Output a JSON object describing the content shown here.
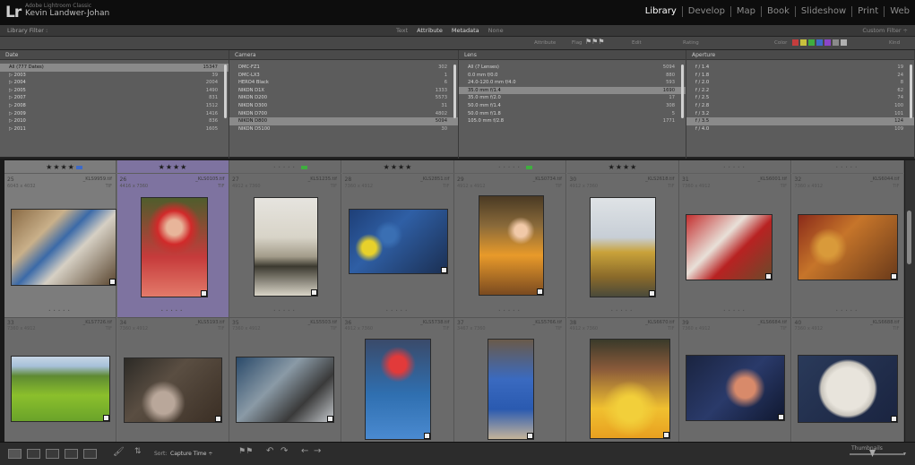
{
  "identity": {
    "logo": "Lr",
    "app_name": "Adobe Lightroom Classic",
    "user": "Kevin Landwer-Johan"
  },
  "modules": [
    {
      "label": "Library",
      "active": true
    },
    {
      "label": "Develop"
    },
    {
      "label": "Map"
    },
    {
      "label": "Book"
    },
    {
      "label": "Slideshow"
    },
    {
      "label": "Print"
    },
    {
      "label": "Web"
    }
  ],
  "library_filter": {
    "title": "Library Filter :",
    "tabs": [
      {
        "label": "Text"
      },
      {
        "label": "Attribute",
        "active": true
      },
      {
        "label": "Metadata",
        "active": true
      },
      {
        "label": "None"
      }
    ],
    "custom": "Custom Filter ÷"
  },
  "attribute_bar": {
    "attribute": "Attribute",
    "flag": "Flag",
    "edit": "Edit",
    "rating": "Rating",
    "color": "Color",
    "kind": "Kind",
    "colors": [
      "#c43d3d",
      "#c9c13d",
      "#3fae3f",
      "#3e6ac7",
      "#8b45c7",
      "#8a8a8a",
      "#b0b0b0"
    ]
  },
  "columns": [
    {
      "header": "Date",
      "rows": [
        {
          "label": "All (777 Dates)",
          "count": "15347",
          "selected": true
        },
        {
          "label": "▷ 2003",
          "count": "39"
        },
        {
          "label": "▷ 2004",
          "count": "2004"
        },
        {
          "label": "▷ 2005",
          "count": "1490"
        },
        {
          "label": "▷ 2007",
          "count": "831"
        },
        {
          "label": "▷ 2008",
          "count": "1512"
        },
        {
          "label": "▷ 2009",
          "count": "1416"
        },
        {
          "label": "▷ 2010",
          "count": "836"
        },
        {
          "label": "▷ 2011",
          "count": "1605"
        }
      ]
    },
    {
      "header": "Camera",
      "rows": [
        {
          "label": "DMC-FZ1",
          "count": "302"
        },
        {
          "label": "DMC-LX3",
          "count": "1"
        },
        {
          "label": "HERO4 Black",
          "count": "6"
        },
        {
          "label": "NIKON D1X",
          "count": "1333"
        },
        {
          "label": "NIKON D200",
          "count": "5573"
        },
        {
          "label": "NIKON D300",
          "count": "31"
        },
        {
          "label": "NIKON D700",
          "count": "4802"
        },
        {
          "label": "NIKON D800",
          "count": "5094",
          "selected": true
        },
        {
          "label": "NIKON D5100",
          "count": "30"
        }
      ]
    },
    {
      "header": "Lens",
      "rows": [
        {
          "label": "All (7 Lenses)",
          "count": "5094"
        },
        {
          "label": "0.0 mm f/0.0",
          "count": "880"
        },
        {
          "label": "24.0-120.0 mm f/4.0",
          "count": "593"
        },
        {
          "label": "35.0 mm f/1.4",
          "count": "1690",
          "selected": true
        },
        {
          "label": "35.0 mm f/2.0",
          "count": "17"
        },
        {
          "label": "50.0 mm f/1.4",
          "count": "308"
        },
        {
          "label": "50.0 mm f/1.8",
          "count": "5"
        },
        {
          "label": "105.0 mm f/2.8",
          "count": "1771"
        }
      ]
    },
    {
      "header": "Aperture",
      "rows": [
        {
          "label": "f / 1.4",
          "count": "19"
        },
        {
          "label": "f / 1.8",
          "count": "24"
        },
        {
          "label": "f / 2.0",
          "count": "8"
        },
        {
          "label": "f / 2.2",
          "count": "62"
        },
        {
          "label": "f / 2.5",
          "count": "74"
        },
        {
          "label": "f / 2.8",
          "count": "100"
        },
        {
          "label": "f / 3.2",
          "count": "101"
        },
        {
          "label": "f / 3.5",
          "count": "124",
          "selected": true
        },
        {
          "label": "f / 4.0",
          "count": "109"
        }
      ]
    }
  ],
  "grid_row1": [
    {
      "idx": "25",
      "file": "_KLS9959.tif",
      "dim": "6043 x 4032",
      "ext": "TIF",
      "stars": "★★★★",
      "flag": "#3e6ac7",
      "selected": true
    },
    {
      "idx": "26",
      "file": "_KLS0105.tif",
      "dim": "4416 x 7360",
      "ext": "TIF",
      "stars": "★★★★",
      "flag": null,
      "highlight": "#7e73a0"
    },
    {
      "idx": "27",
      "file": "_KLS1235.tif",
      "dim": "4912 x 7360",
      "ext": "TIF",
      "stars": "",
      "flag": "#3fae3f"
    },
    {
      "idx": "28",
      "file": "_KLS2851.tif",
      "dim": "7360 x 4912",
      "ext": "TIF",
      "stars": "★★★★",
      "flag": null
    },
    {
      "idx": "29",
      "file": "_KLS0734.tif",
      "dim": "4912 x 4912",
      "ext": "TIF",
      "stars": "",
      "flag": "#3fae3f"
    },
    {
      "idx": "30",
      "file": "_KLS2618.tif",
      "dim": "4912 x 7360",
      "ext": "TIF",
      "stars": "★★★★",
      "flag": null
    },
    {
      "idx": "31",
      "file": "_KLS6001.tif",
      "dim": "7360 x 4912",
      "ext": "TIF",
      "stars": "",
      "flag": null
    },
    {
      "idx": "32",
      "file": "_KLS6044.tif",
      "dim": "7360 x 4912",
      "ext": "TIF",
      "stars": "",
      "flag": null
    }
  ],
  "grid_row2": [
    {
      "idx": "33",
      "file": "_KLS7726.tif",
      "dim": "7360 x 4912",
      "ext": "TIF"
    },
    {
      "idx": "34",
      "file": "_KLS5193.tif",
      "dim": "7360 x 4912",
      "ext": "TIF"
    },
    {
      "idx": "35",
      "file": "_KLS5503.tif",
      "dim": "7360 x 4912",
      "ext": "TIF"
    },
    {
      "idx": "36",
      "file": "_KLS5738.tif",
      "dim": "4912 x 7360",
      "ext": "TIF"
    },
    {
      "idx": "37",
      "file": "_KLS5766.tif",
      "dim": "3467 x 7360",
      "ext": "TIF"
    },
    {
      "idx": "38",
      "file": "_KLS6670.tif",
      "dim": "4912 x 7360",
      "ext": "TIF"
    },
    {
      "idx": "39",
      "file": "_KLS6684.tif",
      "dim": "7360 x 4912",
      "ext": "TIF"
    },
    {
      "idx": "40",
      "file": "_KLS6688.tif",
      "dim": "7360 x 4912",
      "ext": "TIF"
    }
  ],
  "toolbar": {
    "sort_label": "Sort:",
    "sort_value": "Capture Time ÷",
    "thumbnails": "Thumbnails"
  }
}
